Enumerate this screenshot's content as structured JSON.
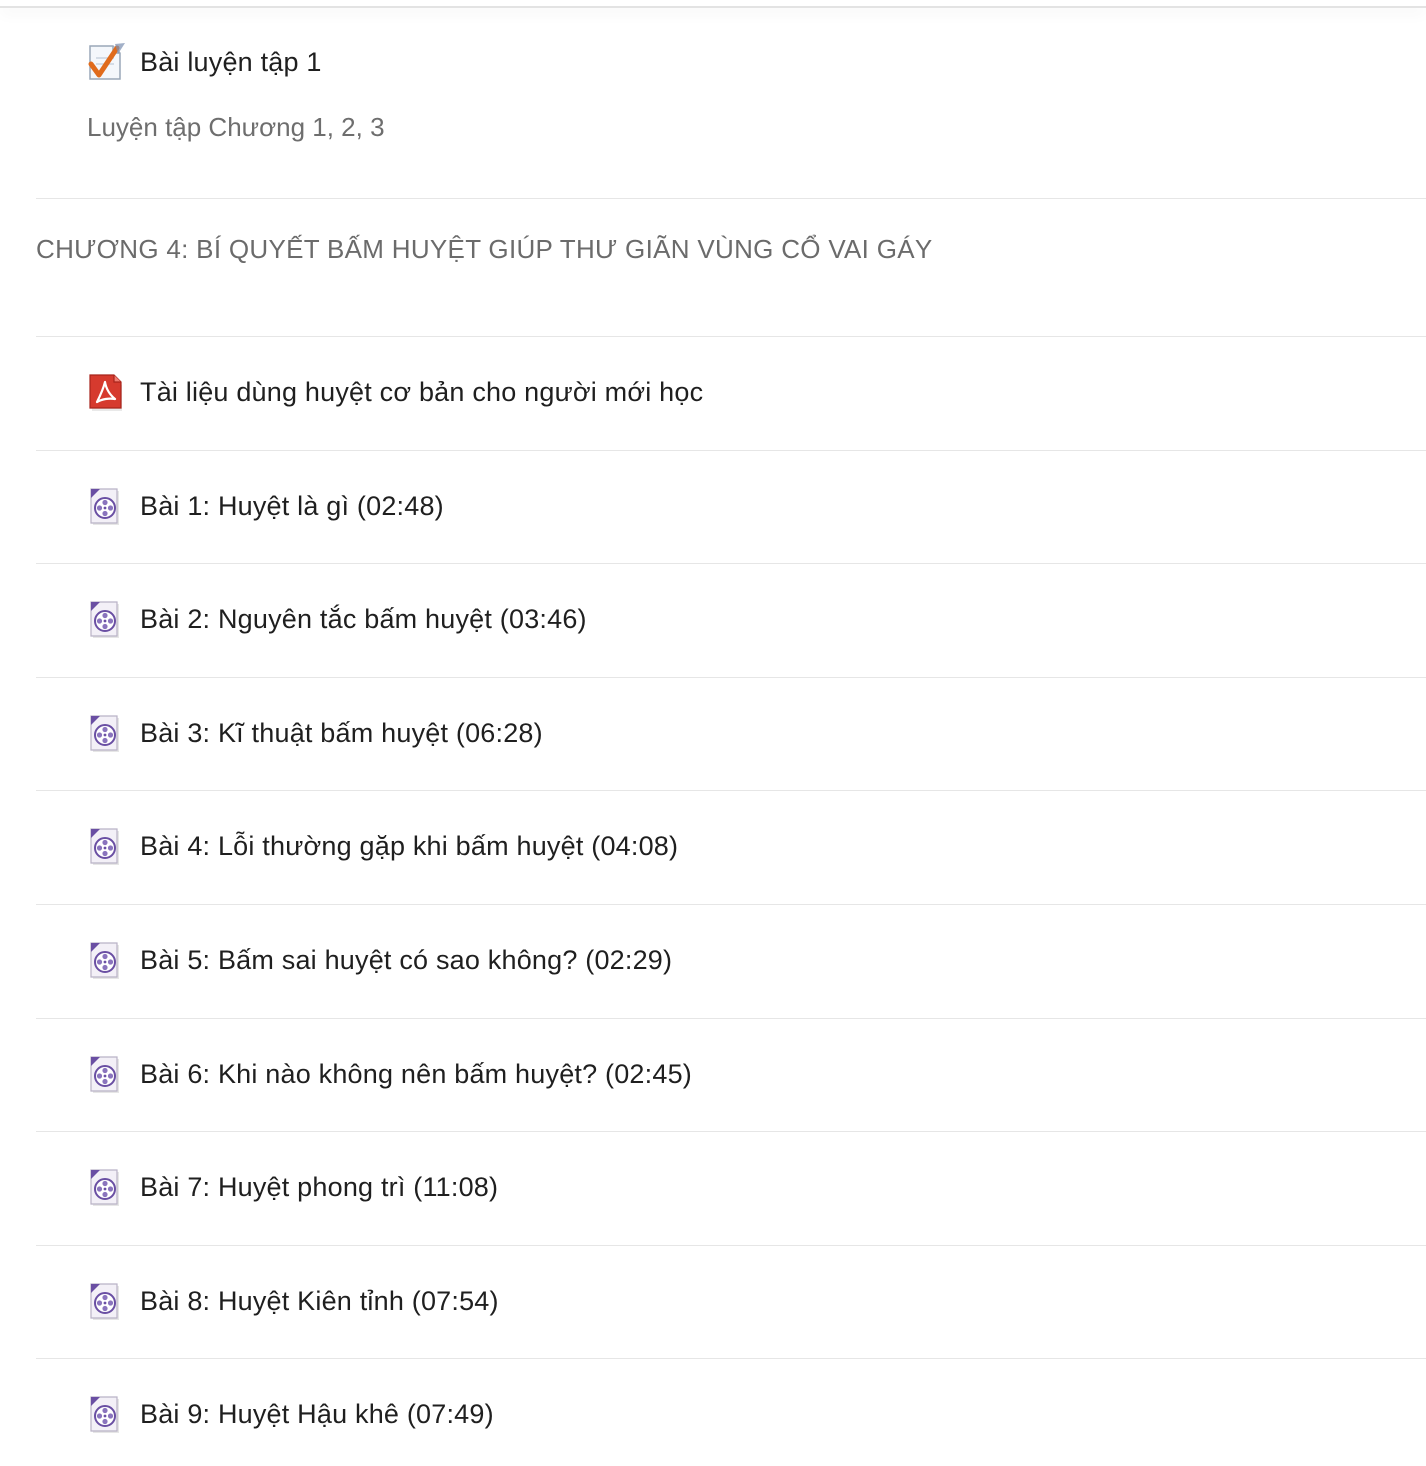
{
  "quiz": {
    "title": "Bài luyện tập 1",
    "description": "Luyện tập Chương 1, 2, 3",
    "icon": "quiz-checkmark-icon"
  },
  "section": {
    "title": "CHƯƠNG 4: BÍ QUYẾT BẤM HUYỆT GIÚP THƯ GIÃN VÙNG CỔ VAI GÁY"
  },
  "resource": {
    "title": "Tài liệu dùng huyệt cơ bản cho người mới học",
    "icon": "pdf-file-icon"
  },
  "lessons": [
    {
      "title": "Bài 1: Huyệt là gì (02:48)",
      "icon": "video-file-icon"
    },
    {
      "title": "Bài 2: Nguyên tắc bấm huyệt (03:46)",
      "icon": "video-file-icon"
    },
    {
      "title": "Bài 3: Kĩ thuật bấm huyệt (06:28)",
      "icon": "video-file-icon"
    },
    {
      "title": "Bài 4: Lỗi thường gặp khi bấm huyệt (04:08)",
      "icon": "video-file-icon"
    },
    {
      "title": "Bài 5: Bấm sai huyệt có sao không? (02:29)",
      "icon": "video-file-icon"
    },
    {
      "title": "Bài 6: Khi nào không nên bấm huyệt? (02:45)",
      "icon": "video-file-icon"
    },
    {
      "title": "Bài 7: Huyệt phong trì (11:08)",
      "icon": "video-file-icon"
    },
    {
      "title": "Bài 8: Huyệt Kiên tỉnh (07:54)",
      "icon": "video-file-icon"
    },
    {
      "title": "Bài 9: Huyệt Hậu khê (07:49)",
      "icon": "video-file-icon"
    }
  ],
  "colors": {
    "text": "#1f1f1f",
    "muted": "#6e6e6e",
    "divider": "#e6e6e6",
    "pdf_red": "#c62b22",
    "video_purple": "#6a4fa3",
    "check_orange": "#e06b1c"
  }
}
